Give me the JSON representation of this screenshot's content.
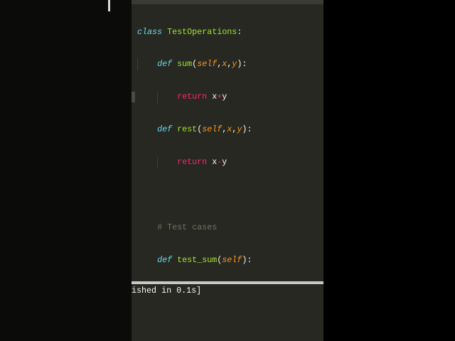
{
  "code": {
    "lines": [
      {
        "kw": "class",
        "name": "TestOperations",
        "tail": ":"
      },
      {
        "kw": "def",
        "name": "sum",
        "open": "(",
        "a1": "self",
        "c1": ",",
        "a2": "x",
        "c2": ",",
        "a3": "y",
        "close": "):"
      },
      {
        "ret": "return",
        "l": "x",
        "op": "+",
        "r": "y"
      },
      {
        "kw": "def",
        "name": "rest",
        "open": "(",
        "a1": "self",
        "c1": ",",
        "a2": "x",
        "c2": ",",
        "a3": "y",
        "close": "):"
      },
      {
        "ret": "return",
        "l": "x",
        "op": "-",
        "r": "y"
      },
      {
        "comment": "# Test cases"
      },
      {
        "kw": "def",
        "name": "test_sum",
        "open": "(",
        "a1": "self",
        "close": "):"
      }
    ]
  },
  "output": {
    "text": "ished in 0.1s]"
  },
  "colors": {
    "background": "#272822",
    "keyword": "#66d9ef",
    "function": "#a6e22e",
    "argument": "#fd971f",
    "return": "#f92672",
    "comment": "#75715e"
  }
}
